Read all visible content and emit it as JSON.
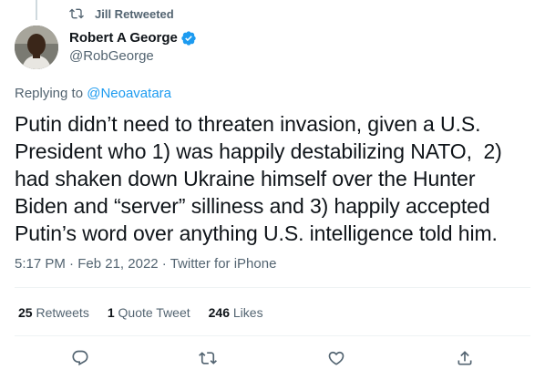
{
  "retweet": {
    "icon": "retweet-icon",
    "label": "Jill Retweeted"
  },
  "user": {
    "name": "Robert A George",
    "handle": "@RobGeorge",
    "verified": true
  },
  "reply": {
    "prefix": "Replying to ",
    "mention": "@Neoavatara"
  },
  "tweet": {
    "text": "Putin didn’t need to threaten invasion, given a U.S. President who 1) was happily destabilizing NATO,  2) had shaken down Ukraine himself over the Hunter Biden and “server” silliness and 3) happily accepted Putin’s word over anything U.S. intelligence told him."
  },
  "meta": {
    "time": "5:17 PM",
    "sep1": " · ",
    "date": "Feb 21, 2022",
    "sep2": " · ",
    "source": "Twitter for iPhone"
  },
  "stats": {
    "retweets_count": "25",
    "retweets_label": " Retweets",
    "quotes_count": "1",
    "quotes_label": " Quote Tweet",
    "likes_count": "246",
    "likes_label": " Likes"
  },
  "actions": [
    "reply-icon",
    "retweet-icon",
    "like-icon",
    "share-icon"
  ],
  "colors": {
    "accent": "#1d9bf0",
    "secondary_text": "#536471",
    "text": "#0f1419",
    "divider": "#eff3f4"
  }
}
